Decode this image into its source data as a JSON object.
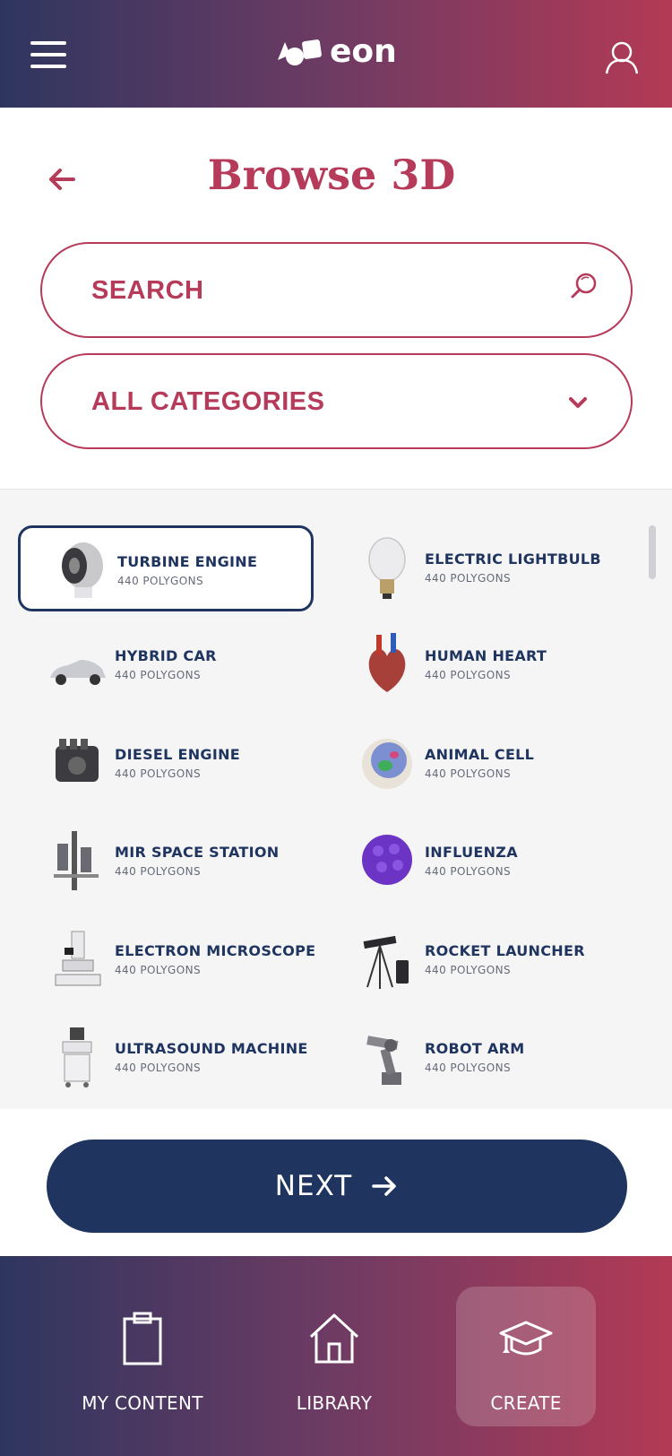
{
  "app": {
    "logo_text": "eon",
    "brand_colors": {
      "primary": "#b63a59",
      "navy": "#1f3560",
      "gradient_start": "#2e3660",
      "gradient_end": "#b33a55"
    }
  },
  "header": {
    "title": "Browse 3D",
    "search_placeholder": "SEARCH",
    "category_selected": "ALL CATEGORIES"
  },
  "items": [
    {
      "name": "TURBINE ENGINE",
      "polygons": "440 POLYGONS",
      "icon": "turbine-engine-icon",
      "selected": true
    },
    {
      "name": "ELECTRIC LIGHTBULB",
      "polygons": "440 POLYGONS",
      "icon": "lightbulb-icon",
      "selected": false
    },
    {
      "name": "HYBRID CAR",
      "polygons": "440 POLYGONS",
      "icon": "car-icon",
      "selected": false
    },
    {
      "name": "HUMAN HEART",
      "polygons": "440 POLYGONS",
      "icon": "heart-icon",
      "selected": false
    },
    {
      "name": "DIESEL ENGINE",
      "polygons": "440 POLYGONS",
      "icon": "diesel-engine-icon",
      "selected": false
    },
    {
      "name": "ANIMAL CELL",
      "polygons": "440 POLYGONS",
      "icon": "animal-cell-icon",
      "selected": false
    },
    {
      "name": "MIR SPACE STATION",
      "polygons": "440 POLYGONS",
      "icon": "space-station-icon",
      "selected": false
    },
    {
      "name": "INFLUENZA",
      "polygons": "440 POLYGONS",
      "icon": "virus-icon",
      "selected": false
    },
    {
      "name": "ELECTRON MICROSCOPE",
      "polygons": "440 POLYGONS",
      "icon": "microscope-icon",
      "selected": false
    },
    {
      "name": "ROCKET LAUNCHER",
      "polygons": "440 POLYGONS",
      "icon": "rocket-launcher-icon",
      "selected": false
    },
    {
      "name": "ULTRASOUND MACHINE",
      "polygons": "440 POLYGONS",
      "icon": "ultrasound-icon",
      "selected": false
    },
    {
      "name": "ROBOT ARM",
      "polygons": "440 POLYGONS",
      "icon": "robot-arm-icon",
      "selected": false
    }
  ],
  "next_button": {
    "label": "NEXT"
  },
  "bottom_nav": [
    {
      "label": "MY CONTENT",
      "icon": "clipboard-icon",
      "active": false
    },
    {
      "label": "LIBRARY",
      "icon": "home-icon",
      "active": false
    },
    {
      "label": "CREATE",
      "icon": "graduation-cap-icon",
      "active": true
    }
  ]
}
